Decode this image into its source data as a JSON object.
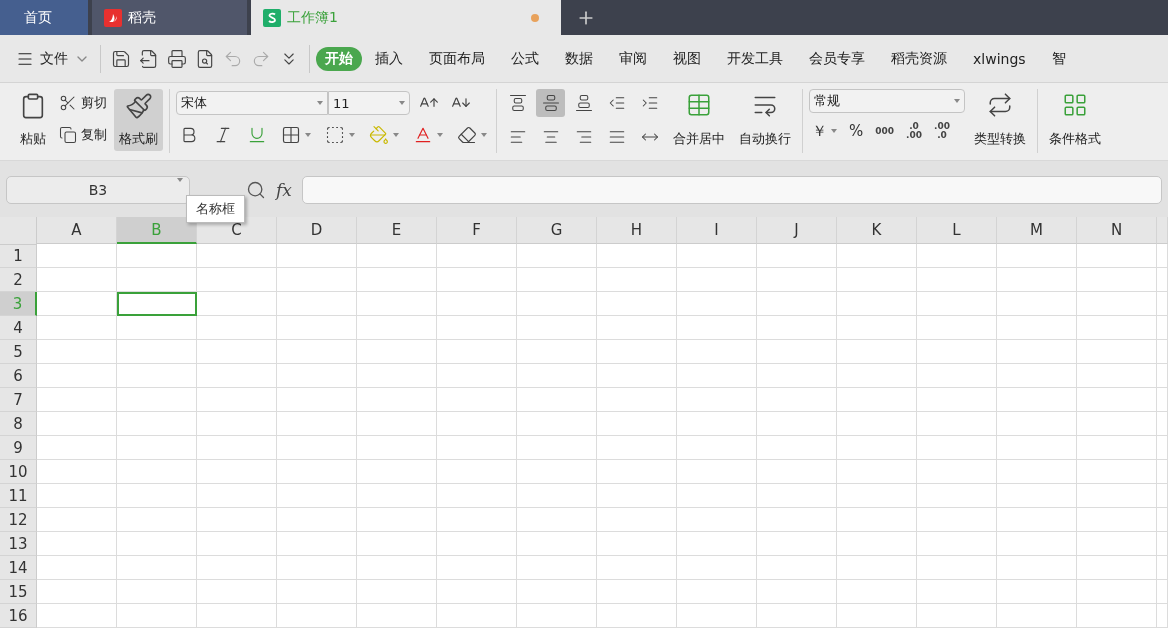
{
  "tabs": [
    {
      "label": "首页",
      "kind": "home",
      "selected": false,
      "modified": false
    },
    {
      "label": "稻壳",
      "kind": "docer",
      "selected": false,
      "modified": false
    },
    {
      "label": "工作簿1",
      "kind": "sheet",
      "selected": true,
      "modified": true
    }
  ],
  "menu": {
    "file": "文件",
    "quick": [
      {
        "kind": "save",
        "disabled": false
      },
      {
        "kind": "export",
        "disabled": false
      },
      {
        "kind": "print",
        "disabled": false
      },
      {
        "kind": "preview",
        "disabled": false
      },
      {
        "kind": "undo",
        "disabled": true
      },
      {
        "kind": "redo",
        "disabled": true
      },
      {
        "kind": "more",
        "disabled": false
      }
    ],
    "tabs": [
      {
        "label": "开始",
        "selected": true
      },
      {
        "label": "插入",
        "selected": false
      },
      {
        "label": "页面布局",
        "selected": false
      },
      {
        "label": "公式",
        "selected": false
      },
      {
        "label": "数据",
        "selected": false
      },
      {
        "label": "审阅",
        "selected": false
      },
      {
        "label": "视图",
        "selected": false
      },
      {
        "label": "开发工具",
        "selected": false
      },
      {
        "label": "会员专享",
        "selected": false
      },
      {
        "label": "稻壳资源",
        "selected": false
      },
      {
        "label": "xlwings",
        "selected": false
      },
      {
        "label": "智",
        "selected": false
      }
    ]
  },
  "ribbon": {
    "paste": "粘贴",
    "cut": "剪切",
    "copy": "复制",
    "format_painter": {
      "label": "格式刷",
      "selected": true
    },
    "font_name": "宋体",
    "font_size": "11",
    "align": [
      {
        "kind": "top",
        "selected": false
      },
      {
        "kind": "middle",
        "selected": true
      },
      {
        "kind": "bottom",
        "selected": false
      },
      {
        "kind": "outdent",
        "selected": false
      },
      {
        "kind": "indent",
        "selected": false
      },
      {
        "kind": "left",
        "selected": false
      },
      {
        "kind": "center",
        "selected": false
      },
      {
        "kind": "right",
        "selected": false
      },
      {
        "kind": "justify",
        "selected": false
      },
      {
        "kind": "distributed",
        "selected": false
      }
    ],
    "merge": "合并居中",
    "wrap": "自动换行",
    "number_format": "常规",
    "currency": "￥",
    "percent": "%",
    "thousands": "000",
    "decimal_up": [
      ".0",
      ".00"
    ],
    "decimal_down": [
      ".00",
      ".0"
    ],
    "convert": "类型转换",
    "conditional": "条件格式"
  },
  "formula_bar": {
    "name_box": "B3",
    "tooltip": "名称框",
    "fx": "fx"
  },
  "sheet": {
    "columns": [
      {
        "label": "A",
        "selected": false
      },
      {
        "label": "B",
        "selected": true
      },
      {
        "label": "C",
        "selected": false
      },
      {
        "label": "D",
        "selected": false
      },
      {
        "label": "E",
        "selected": false
      },
      {
        "label": "F",
        "selected": false
      },
      {
        "label": "G",
        "selected": false
      },
      {
        "label": "H",
        "selected": false
      },
      {
        "label": "I",
        "selected": false
      },
      {
        "label": "J",
        "selected": false
      },
      {
        "label": "K",
        "selected": false
      },
      {
        "label": "L",
        "selected": false
      },
      {
        "label": "M",
        "selected": false
      },
      {
        "label": "N",
        "selected": false
      }
    ],
    "rows": [
      {
        "label": "1",
        "selected": false
      },
      {
        "label": "2",
        "selected": false
      },
      {
        "label": "3",
        "selected": true
      },
      {
        "label": "4",
        "selected": false
      },
      {
        "label": "5",
        "selected": false
      },
      {
        "label": "6",
        "selected": false
      },
      {
        "label": "7",
        "selected": false
      },
      {
        "label": "8",
        "selected": false
      },
      {
        "label": "9",
        "selected": false
      },
      {
        "label": "10",
        "selected": false
      },
      {
        "label": "11",
        "selected": false
      },
      {
        "label": "12",
        "selected": false
      },
      {
        "label": "13",
        "selected": false
      },
      {
        "label": "14",
        "selected": false
      },
      {
        "label": "15",
        "selected": false
      },
      {
        "label": "16",
        "selected": false
      }
    ]
  }
}
